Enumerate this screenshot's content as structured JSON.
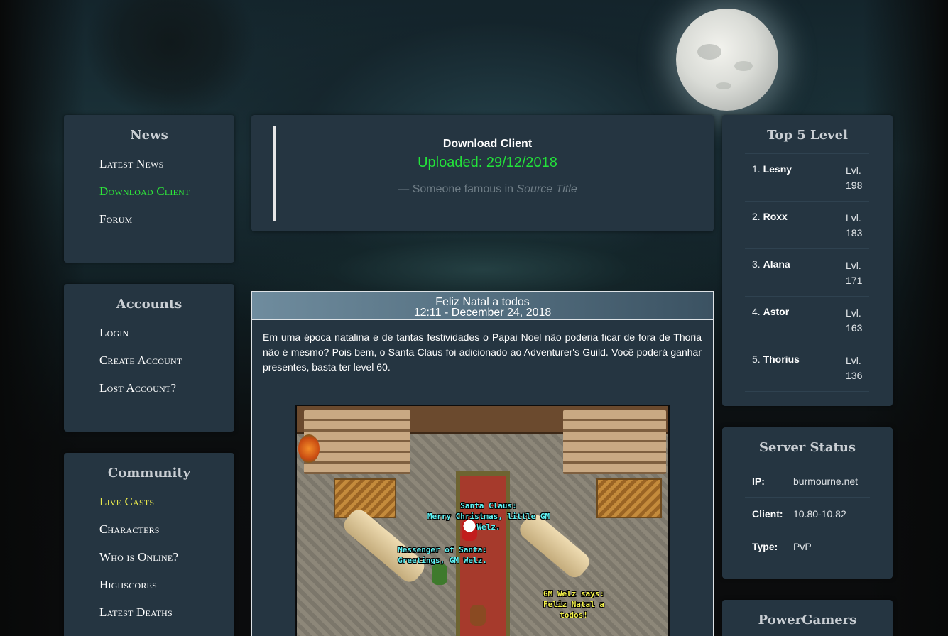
{
  "news": {
    "title": "News",
    "items": [
      {
        "label": "Latest News"
      },
      {
        "label": "Download Client"
      },
      {
        "label": "Forum"
      }
    ]
  },
  "accounts": {
    "title": "Accounts",
    "items": [
      {
        "label": "Login"
      },
      {
        "label": "Create Account"
      },
      {
        "label": "Lost Account?"
      }
    ]
  },
  "community": {
    "title": "Community",
    "items": [
      {
        "label": "Live Casts"
      },
      {
        "label": "Characters"
      },
      {
        "label": "Who is Online?"
      },
      {
        "label": "Highscores"
      },
      {
        "label": "Latest Deaths"
      }
    ]
  },
  "download": {
    "title": "Download Client",
    "uploaded": "Uploaded: 29/12/2018",
    "footer_prefix": "— Someone famous in",
    "footer_source": "Source Title"
  },
  "article": {
    "title": "Feliz Natal a todos",
    "date": "12:11 - December 24, 2018",
    "body": "Em uma época natalina e de tantas festividades o Papai Noel não poderia ficar de fora de Thoria não é mesmo? Pois bem, o Santa Claus foi adicionado ao Adventurer's Guild. Você poderá ganhar presentes, basta ter level 60.",
    "screenshot": {
      "santa_line1": "Santa Claus:",
      "santa_line2": "Merry Christmas, little GM Welz.",
      "messenger_line1": "Messenger of Santa:",
      "messenger_line2": "Greetings, GM Welz.",
      "gm_line1": "GM Welz says:",
      "gm_line2": "Feliz Natal a todos!"
    }
  },
  "top5": {
    "title": "Top 5 Level",
    "players": [
      {
        "rank": "1.",
        "name": "Lesny",
        "lvl_label": "Lvl.",
        "level": "198"
      },
      {
        "rank": "2.",
        "name": "Roxx",
        "lvl_label": "Lvl.",
        "level": "183"
      },
      {
        "rank": "3.",
        "name": "Alana",
        "lvl_label": "Lvl.",
        "level": "171"
      },
      {
        "rank": "4.",
        "name": "Astor",
        "lvl_label": "Lvl.",
        "level": "163"
      },
      {
        "rank": "5.",
        "name": "Thorius",
        "lvl_label": "Lvl.",
        "level": "136"
      }
    ]
  },
  "status": {
    "title": "Server Status",
    "rows": [
      {
        "key": "IP:",
        "value": "burmourne.net"
      },
      {
        "key": "Client:",
        "value": "10.80-10.82"
      },
      {
        "key": "Type:",
        "value": "PvP"
      }
    ]
  },
  "powergamers": {
    "title": "PowerGamers"
  },
  "colors": {
    "panel": "#253541",
    "active_link": "#2ee83a",
    "live_link": "#e8e84c",
    "uploaded": "#23e23a"
  }
}
